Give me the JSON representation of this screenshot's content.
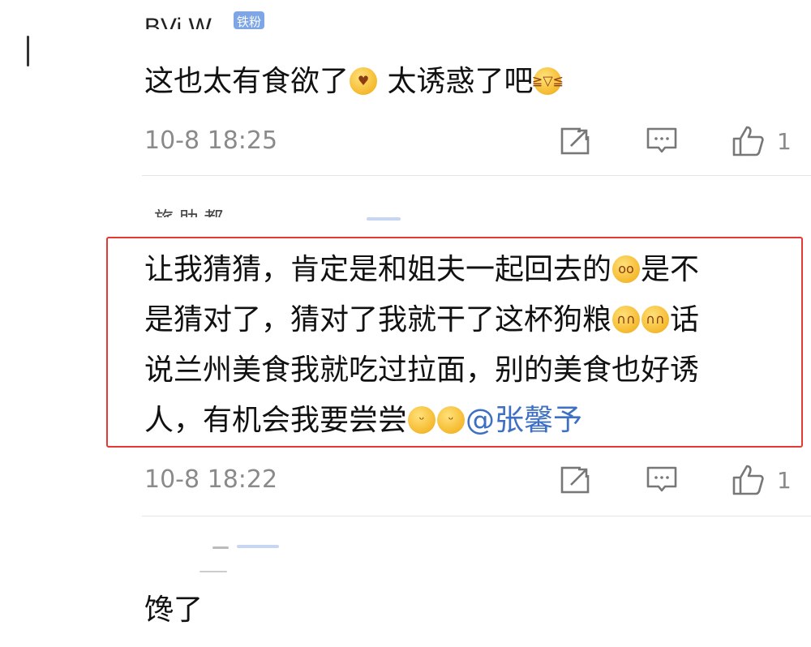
{
  "comments": [
    {
      "author": "BVi  W",
      "badge": "铁粉",
      "segments": [
        {
          "type": "text",
          "value": "这也太有食欲了"
        },
        {
          "type": "emoji",
          "name": "heart-eyes-emoji",
          "glyph": "♥"
        },
        {
          "type": "text",
          "value": " 太诱惑了吧"
        },
        {
          "type": "emoji",
          "name": "laughing-tears-emoji",
          "glyph": "≧▽≦"
        }
      ],
      "timestamp": "10-8 18:25",
      "likes": "1"
    },
    {
      "author": "旅 助 都",
      "lines": [
        [
          {
            "type": "text",
            "value": "让我猜猜，肯定是和姐夫一起回去的"
          },
          {
            "type": "emoji",
            "name": "glasses-emoji",
            "glyph": "oo"
          },
          {
            "type": "text",
            "value": "是不"
          }
        ],
        [
          {
            "type": "text",
            "value": "是猜对了，猜对了我就干了这杯狗粮"
          },
          {
            "type": "emoji",
            "name": "shy-emoji",
            "glyph": "∩∩"
          },
          {
            "type": "emoji",
            "name": "shy-emoji",
            "glyph": "∩∩"
          },
          {
            "type": "text",
            "value": "话"
          }
        ],
        [
          {
            "type": "text",
            "value": "说兰州美食我就吃过拉面，别的美食也好诱"
          }
        ],
        [
          {
            "type": "text",
            "value": "人，有机会我要尝尝"
          },
          {
            "type": "emoji",
            "name": "tongue-out-emoji",
            "glyph": "ᵕ"
          },
          {
            "type": "emoji",
            "name": "tongue-out-emoji",
            "glyph": "ᵕ"
          },
          {
            "type": "mention",
            "value": "@张馨予"
          }
        ]
      ],
      "timestamp": "10-8 18:22",
      "likes": "1",
      "highlighted": true
    },
    {
      "author": "",
      "segments": [
        {
          "type": "text",
          "value": "馋了"
        }
      ]
    }
  ],
  "colors": {
    "highlight": "#e53935",
    "mention": "#3d6fc3",
    "meta": "#8a8a8a"
  }
}
